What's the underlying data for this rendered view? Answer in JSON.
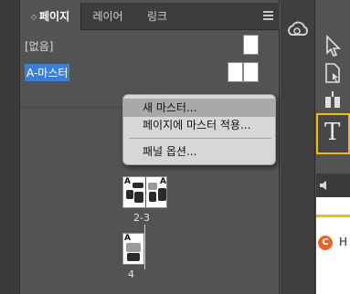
{
  "tabs": [
    {
      "label": "페이지",
      "active": true
    },
    {
      "label": "레이어",
      "active": false
    },
    {
      "label": "링크",
      "active": false
    }
  ],
  "masters": [
    {
      "label": "[없음]",
      "selected": false
    },
    {
      "label": "A-마스터",
      "selected": true
    }
  ],
  "thumbnails": {
    "mini_label": "A",
    "spread_label": "2-3",
    "single_label": "4"
  },
  "context_menu": {
    "items": [
      {
        "label": "새 마스터...",
        "highlighted": true
      },
      {
        "label": "페이지에 마스터 적용...",
        "highlighted": false
      },
      {
        "label": "패널 옵션...",
        "highlighted": false
      }
    ]
  },
  "right_panel": {
    "text_tool_glyph": "T",
    "badge_letter": "C",
    "partial_text": "H"
  },
  "colors": {
    "selection": "#3c7fd6",
    "active_tool_border": "#f0c000",
    "badge": "#e8642a"
  },
  "icons": [
    "panel-menu-icon",
    "creative-cloud-icon",
    "selection-tool-icon",
    "page-tool-icon",
    "gap-tool-icon",
    "type-tool-icon",
    "speaker-icon"
  ]
}
